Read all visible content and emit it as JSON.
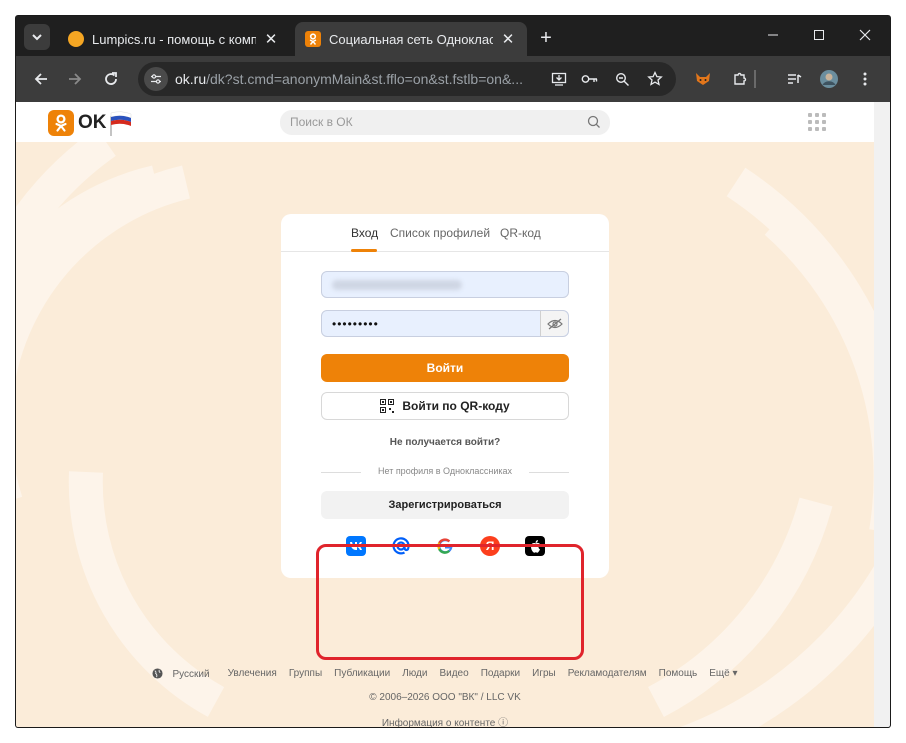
{
  "browser": {
    "tabs": [
      {
        "title": "Lumpics.ru - помощь с компьютером",
        "active": false
      },
      {
        "title": "Социальная сеть Одноклассники",
        "active": true
      }
    ],
    "new_tab_label": "+",
    "url": {
      "host": "ok.ru",
      "path": "/dk?st.cmd=anonymMain&st.fflo=on&st.fstlb=on&..."
    }
  },
  "header": {
    "logo_text": "OK",
    "search_placeholder": "Поиск в ОК"
  },
  "login": {
    "tabs": [
      "Вход",
      "Список профилей",
      "QR-код"
    ],
    "login_value": "",
    "password_masked": "•••••••••",
    "submit_label": "Войти",
    "qr_label": "Войти по QR-коду",
    "forgot_label": "Не получается войти?",
    "no_profile_label": "Нет профиля в Одноклассниках",
    "register_label": "Зарегистрироваться",
    "social": [
      {
        "name": "vk",
        "glyph": "vk",
        "color": "#0077ff"
      },
      {
        "name": "mail",
        "glyph": "@",
        "color": "#005ff9"
      },
      {
        "name": "google",
        "glyph": "G",
        "color": "#4285f4"
      },
      {
        "name": "yandex",
        "glyph": "Я",
        "color": "#fc3f1d"
      },
      {
        "name": "apple",
        "glyph": "",
        "color": "#000000"
      }
    ]
  },
  "footer": {
    "links": [
      "Русский",
      "Увлечения",
      "Группы",
      "Публикации",
      "Люди",
      "Видео",
      "Подарки",
      "Игры",
      "Рекламодателям",
      "Помощь",
      "Ещё ▾"
    ],
    "copyright": "© 2006–2026 ООО \"ВК\" / LLC VK",
    "content_info": "Информация о контенте ⓘ"
  },
  "colors": {
    "accent": "#ee8208",
    "highlight": "#e0242c"
  }
}
